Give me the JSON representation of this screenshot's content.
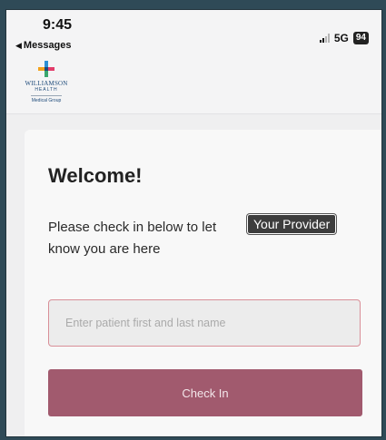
{
  "status_bar": {
    "time": "9:45",
    "back_label": "Messages",
    "network": "5G",
    "battery": "94"
  },
  "logo": {
    "name": "WILLIAMSON",
    "sub": "HEALTH",
    "group": "Medical Group"
  },
  "page": {
    "title": "Welcome!",
    "instructions": "Please check in below to let",
    "instructions_line2": "know you are here",
    "tooltip": "Your Provider"
  },
  "form": {
    "name_placeholder": "Enter patient first and last name",
    "name_value": "",
    "checkin_label": "Check In"
  },
  "colors": {
    "accent": "#a15a6e",
    "input_border": "#d98f98",
    "logo_blue": "#1d4a7a"
  }
}
